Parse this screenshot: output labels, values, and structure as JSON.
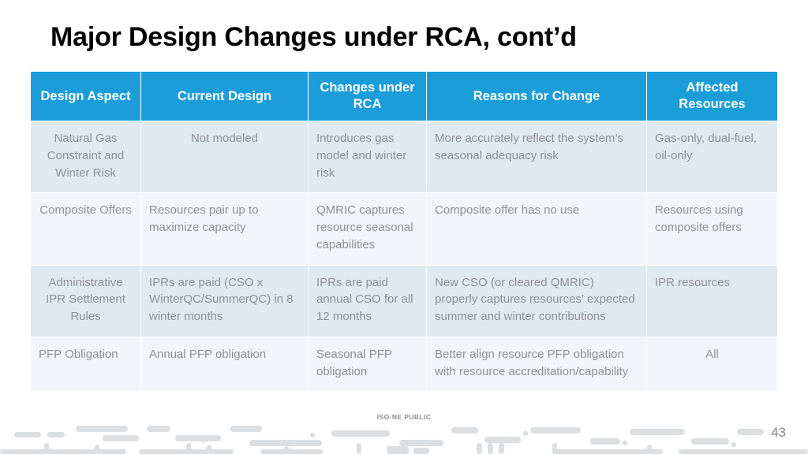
{
  "slide": {
    "title": "Major Design Changes under RCA, cont’d",
    "page_number": "43",
    "footer_label": "ISO-NE PUBLIC"
  },
  "colors": {
    "header_bg": "#1b9dd9",
    "header_text": "#ffffff",
    "row_shade": "#dfe9f2",
    "row_plain": "#f2f6fa",
    "body_text": "#8e9196",
    "title_text": "#000000"
  },
  "table": {
    "headers": [
      "Design Aspect",
      "Current Design",
      "Changes under RCA",
      "Reasons for Change",
      "Affected Resources"
    ],
    "rows": [
      {
        "shade": true,
        "cells": [
          "Natural Gas Constraint and Winter Risk",
          "Not modeled",
          "Introduces gas model and winter risk",
          "More accurately reflect the system’s seasonal adequacy risk",
          "Gas-only, dual-fuel, oil-only"
        ],
        "align": [
          "center",
          "center",
          "left",
          "left",
          "left"
        ]
      },
      {
        "shade": false,
        "cells": [
          "Composite Offers",
          "Resources pair up to maximize capacity",
          "QMRIC captures resource seasonal capabilities",
          "Composite offer has no use",
          "Resources using composite offers"
        ],
        "align": [
          "center",
          "left",
          "left",
          "left",
          "left"
        ]
      },
      {
        "shade": true,
        "cells": [
          "Administrative IPR Settlement Rules",
          "IPRs are paid (CSO x WinterQC/SummerQC) in 8 winter months",
          "IPRs are paid annual CSO for all 12 months",
          "New CSO (or cleared QMRIC) properly captures resources’ expected summer and winter contributions",
          "IPR resources"
        ],
        "align": [
          "center",
          "left",
          "left",
          "left",
          "left"
        ]
      },
      {
        "shade": false,
        "cells": [
          "PFP Obligation",
          "Annual PFP obligation",
          "Seasonal PFP obligation",
          "Better align resource PFP obligation with resource accreditation/capability",
          "All"
        ],
        "align": [
          "left",
          "left",
          "left",
          "left",
          "center"
        ]
      }
    ]
  }
}
